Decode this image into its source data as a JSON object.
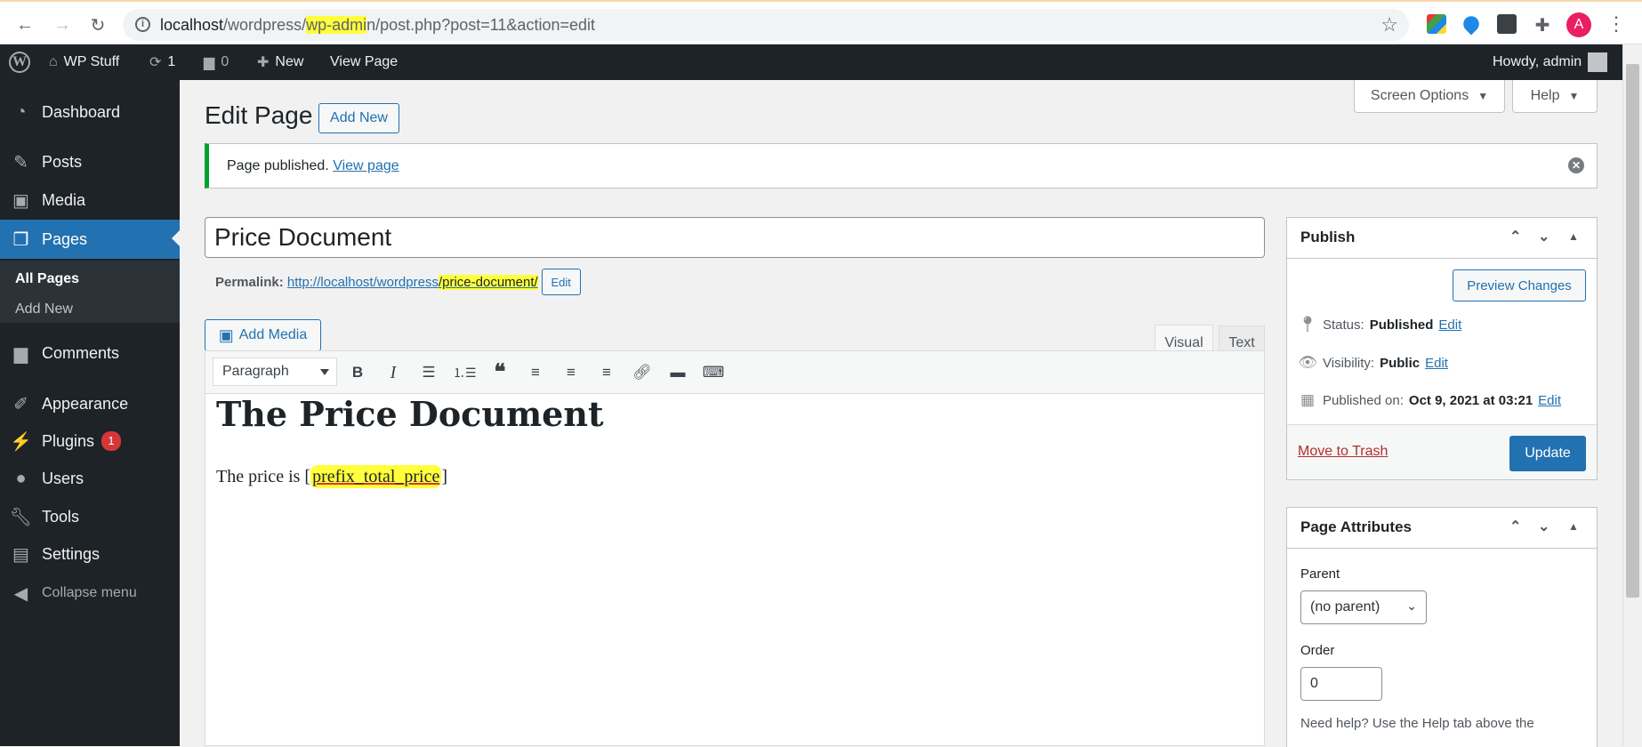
{
  "browser": {
    "url_host": "localhost",
    "url_path_a": "/wordpress/",
    "url_highlight_a": "wp-admi",
    "url_highlight_b": "n",
    "url_rest": "/post.php?post=11&action=edit",
    "profile_initial": "A"
  },
  "adminbar": {
    "site_name": "WP Stuff",
    "updates_count": "1",
    "comments_count": "0",
    "new_label": "New",
    "view_page_label": "View Page",
    "howdy": "Howdy, admin"
  },
  "sidebar": {
    "items": [
      {
        "label": "Dashboard",
        "icon": "dashboard-icon"
      },
      {
        "label": "Posts",
        "icon": "pin-icon"
      },
      {
        "label": "Media",
        "icon": "media-icon"
      },
      {
        "label": "Pages",
        "icon": "pages-icon"
      },
      {
        "label": "Comments",
        "icon": "comment-icon"
      },
      {
        "label": "Appearance",
        "icon": "brush-icon"
      },
      {
        "label": "Plugins",
        "icon": "plugin-icon"
      },
      {
        "label": "Users",
        "icon": "users-icon"
      },
      {
        "label": "Tools",
        "icon": "wrench-icon"
      },
      {
        "label": "Settings",
        "icon": "settings-icon"
      },
      {
        "label": "Collapse menu",
        "icon": "collapse-icon"
      }
    ],
    "submenu": {
      "all_pages": "All Pages",
      "add_new": "Add New"
    },
    "plugins_badge": "1"
  },
  "header": {
    "title": "Edit Page",
    "add_new": "Add New",
    "screen_options": "Screen Options",
    "help": "Help"
  },
  "notice": {
    "text": "Page published.",
    "link": "View page"
  },
  "post": {
    "title": "Price Document",
    "permalink_label": "Permalink:",
    "permalink_base": "http://localhost/wordpress",
    "permalink_slug": "/price-document/",
    "permalink_edit": "Edit"
  },
  "editor": {
    "add_media": "Add Media",
    "tab_visual": "Visual",
    "tab_text": "Text",
    "format": "Paragraph",
    "heading": "The Price Document",
    "para_before": "The price is [",
    "shortcode": "prefix_total_price",
    "para_after": "]"
  },
  "publish": {
    "title": "Publish",
    "preview": "Preview Changes",
    "status_label": "Status:",
    "status_value": "Published",
    "visibility_label": "Visibility:",
    "visibility_value": "Public",
    "published_label": "Published on:",
    "published_value": "Oct 9, 2021 at 03:21",
    "edit": "Edit",
    "trash": "Move to Trash",
    "update": "Update"
  },
  "attributes": {
    "title": "Page Attributes",
    "parent_label": "Parent",
    "parent_value": "(no parent)",
    "order_label": "Order",
    "order_value": "0",
    "help_text": "Need help? Use the Help tab above the"
  },
  "colors": {
    "accent": "#2271b1",
    "adminbar": "#1d2327",
    "success": "#00a32a",
    "badge": "#d63638",
    "highlight": "#ffff3b"
  }
}
